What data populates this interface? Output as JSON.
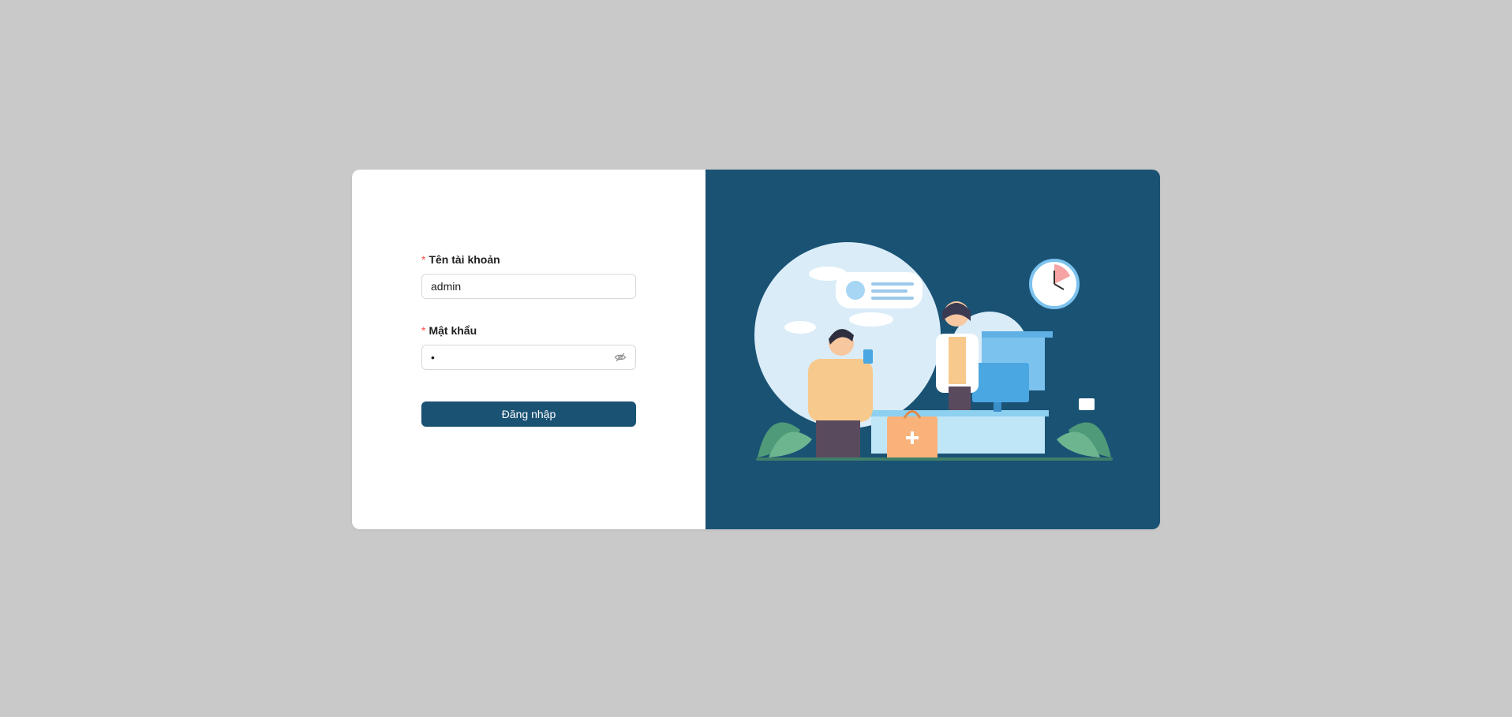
{
  "login": {
    "username": {
      "label": "Tên tài khoản",
      "required_mark": "*",
      "value": "admin"
    },
    "password": {
      "label": "Mật khẩu",
      "required_mark": "*",
      "value": "•",
      "toggle_icon": "eye-invisible-icon"
    },
    "submit_label": "Đăng nhập"
  },
  "colors": {
    "background": "#c9c9c9",
    "card": "#ffffff",
    "brand": "#1a5274",
    "required": "#ff4d4f"
  },
  "illustration": {
    "subject": "pharmacist serving customer at pharmacy counter"
  }
}
